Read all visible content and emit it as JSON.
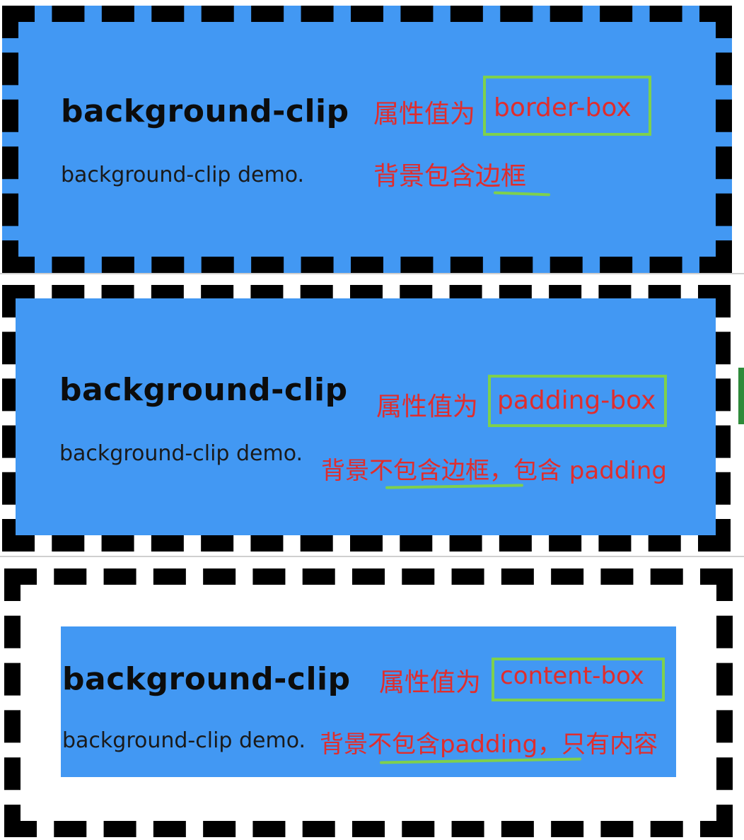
{
  "colors": {
    "element_background": "#4298f3",
    "border": "#000000",
    "annotation_text": "#e02d2d",
    "annotation_highlight": "#7ed04d"
  },
  "panels": [
    {
      "heading": "background-clip",
      "subtext": "background-clip demo.",
      "value_prefix": "属性值为",
      "value": "border-box",
      "description": "背景包含边框"
    },
    {
      "heading": "background-clip",
      "subtext": "background-clip demo.",
      "value_prefix": "属性值为",
      "value": "padding-box",
      "description": "背景不包含边框，包含 padding"
    },
    {
      "heading": "background-clip",
      "subtext": "background-clip demo.",
      "value_prefix": "属性值为",
      "value": "content-box",
      "description": "背景不包含padding，只有内容"
    }
  ]
}
